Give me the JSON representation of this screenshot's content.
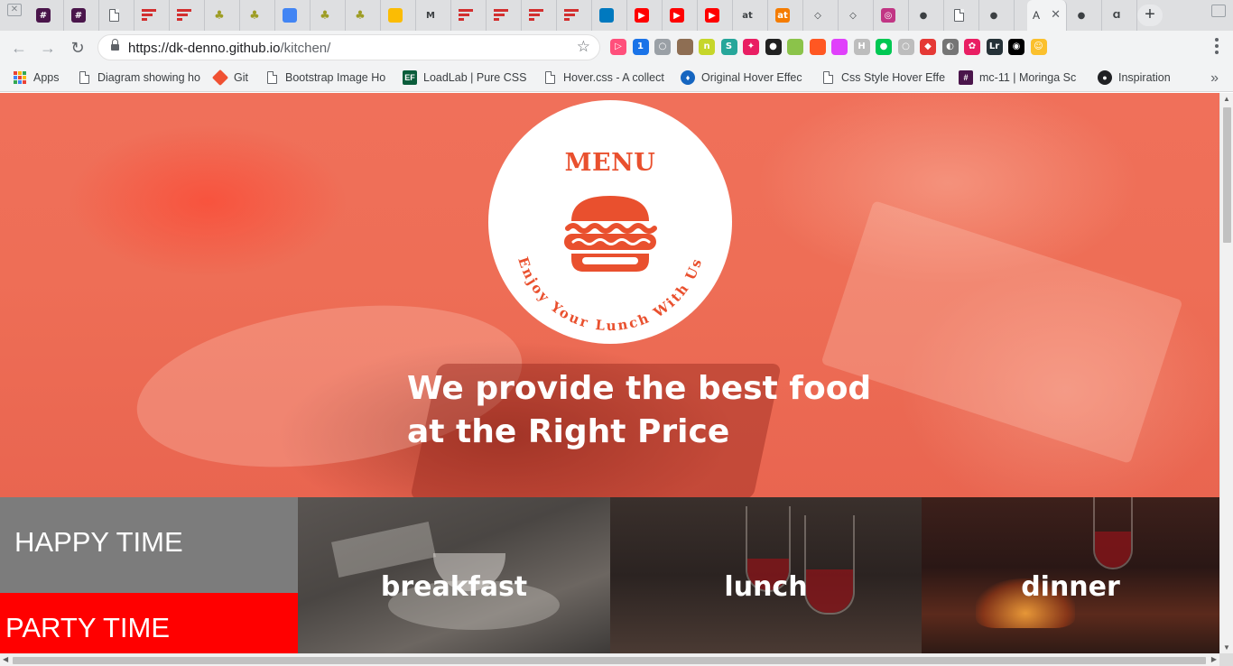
{
  "browser": {
    "active_tab_title": "A",
    "tabs": [
      {
        "icon": "slack-hash-icon",
        "glyph": "#",
        "color": "#4a154b"
      },
      {
        "icon": "slack-hash-icon",
        "glyph": "#",
        "color": "#4a154b"
      },
      {
        "icon": "page-icon",
        "glyph": "",
        "color": "#ffffff"
      },
      {
        "icon": "trello-red-icon",
        "glyph": "",
        "color": "#d32f2f"
      },
      {
        "icon": "trello-red-icon",
        "glyph": "",
        "color": "#d32f2f"
      },
      {
        "icon": "tree-icon",
        "glyph": "",
        "color": "#9e9d24"
      },
      {
        "icon": "tree-icon",
        "glyph": "",
        "color": "#9e9d24"
      },
      {
        "icon": "docs-icon",
        "glyph": "",
        "color": "#4285f4"
      },
      {
        "icon": "tree-icon",
        "glyph": "",
        "color": "#9e9d24"
      },
      {
        "icon": "tree-icon",
        "glyph": "",
        "color": "#9e9d24"
      },
      {
        "icon": "keep-icon",
        "glyph": "",
        "color": "#fbbc04"
      },
      {
        "icon": "gmail-icon",
        "glyph": "M",
        "color": "#ffffff"
      },
      {
        "icon": "red-bars-icon",
        "glyph": "",
        "color": "#d32f2f"
      },
      {
        "icon": "red-bars-icon",
        "glyph": "",
        "color": "#d32f2f"
      },
      {
        "icon": "red-bars-icon",
        "glyph": "",
        "color": "#d32f2f"
      },
      {
        "icon": "red-bars-icon",
        "glyph": "",
        "color": "#d32f2f"
      },
      {
        "icon": "trello-icon",
        "glyph": "",
        "color": "#0079bf"
      },
      {
        "icon": "youtube-icon",
        "glyph": "▶",
        "color": "#ff0000"
      },
      {
        "icon": "youtube-icon",
        "glyph": "▶",
        "color": "#ff0000"
      },
      {
        "icon": "youtube-icon",
        "glyph": "▶",
        "color": "#ff0000"
      },
      {
        "icon": "at-icon",
        "glyph": "at",
        "color": "#ffffff"
      },
      {
        "icon": "at-orange-icon",
        "glyph": "at",
        "color": "#f57c00"
      },
      {
        "icon": "codepen-icon",
        "glyph": "◇",
        "color": "#ffffff"
      },
      {
        "icon": "codepen-icon",
        "glyph": "◇",
        "color": "#ffffff"
      },
      {
        "icon": "instagram-icon",
        "glyph": "◎",
        "color": "#c13584"
      },
      {
        "icon": "github-icon",
        "glyph": "●",
        "color": "#ffffff"
      },
      {
        "icon": "page-icon",
        "glyph": "",
        "color": "#ffffff"
      },
      {
        "icon": "github-icon",
        "glyph": "●",
        "color": "#ffffff"
      }
    ],
    "after_active_tabs": [
      {
        "icon": "github-icon",
        "glyph": "●",
        "color": "#ffffff"
      },
      {
        "icon": "dk-icon",
        "glyph": "Ɑ",
        "color": "#ffffff"
      }
    ],
    "url_host": "https://dk-denno.github.io",
    "url_path": "/kitchen/",
    "extensions": [
      {
        "icon": "ext-play-icon",
        "color": "#ff4f7b",
        "glyph": "▷"
      },
      {
        "icon": "ext-ghostery-icon",
        "color": "#1a73e8",
        "glyph": "1"
      },
      {
        "icon": "ext-circle-icon",
        "color": "#9aa0a6",
        "glyph": "○"
      },
      {
        "icon": "ext-photo-icon",
        "color": "#8e6e53",
        "glyph": ""
      },
      {
        "icon": "ext-n-icon",
        "color": "#c6d62a",
        "glyph": "n"
      },
      {
        "icon": "ext-s-icon",
        "color": "#26a69a",
        "glyph": "S"
      },
      {
        "icon": "ext-unicorn-icon",
        "color": "#e91e63",
        "glyph": "✦"
      },
      {
        "icon": "ext-dark-circle-icon",
        "color": "#212121",
        "glyph": "●"
      },
      {
        "icon": "ext-green-square-icon",
        "color": "#8bc34a",
        "glyph": ""
      },
      {
        "icon": "ext-colorful-icon",
        "color": "#ff5722",
        "glyph": ""
      },
      {
        "icon": "ext-pink-page-icon",
        "color": "#e040fb",
        "glyph": ""
      },
      {
        "icon": "ext-h-icon",
        "color": "#bdbdbd",
        "glyph": "H"
      },
      {
        "icon": "ext-green-circle-icon",
        "color": "#00c853",
        "glyph": "●"
      },
      {
        "icon": "ext-grey-circle-icon",
        "color": "#bdbdbd",
        "glyph": "○"
      },
      {
        "icon": "ext-red-shield-icon",
        "color": "#e53935",
        "glyph": "◆"
      },
      {
        "icon": "ext-bulb-icon",
        "color": "#757575",
        "glyph": "◐"
      },
      {
        "icon": "ext-colorwheel-icon",
        "color": "#e91e63",
        "glyph": "✿"
      },
      {
        "icon": "ext-lr-icon",
        "color": "#263238",
        "glyph": "Lr"
      },
      {
        "icon": "ext-black-circle-icon",
        "color": "#000000",
        "glyph": "◉"
      },
      {
        "icon": "ext-emoji-icon",
        "color": "#fbc02d",
        "glyph": "☺"
      }
    ]
  },
  "bookmarks": [
    {
      "label": "Apps",
      "icon": "apps-grid-icon"
    },
    {
      "label": "Diagram showing ho",
      "icon": "page-icon"
    },
    {
      "label": "Git",
      "icon": "git-icon"
    },
    {
      "label": "Bootstrap Image Ho",
      "icon": "page-icon"
    },
    {
      "label": "LoadLab | Pure CSS",
      "icon": "ef-icon"
    },
    {
      "label": "Hover.css - A collect",
      "icon": "page-icon"
    },
    {
      "label": "Original Hover Effec",
      "icon": "drop-icon"
    },
    {
      "label": "Css Style Hover Effe",
      "icon": "page-icon"
    },
    {
      "label": "mc-11 | Moringa Sc",
      "icon": "slack-hash-icon"
    },
    {
      "label": "Inspiration",
      "icon": "github-icon"
    }
  ],
  "page": {
    "badge": {
      "title": "MENU",
      "arc_text": "Enjoy Your Lunch With Us"
    },
    "tagline": {
      "line1": "We provide the best food",
      "line2": "at the Right Price"
    },
    "happy_time": "HAPPY TIME",
    "party_time": "PARTY TIME",
    "meals": {
      "breakfast": "breakfast",
      "lunch": "lunch",
      "dinner": "dinner"
    }
  },
  "colors": {
    "brand": "#e9502e",
    "hero_overlay": "#ef6d55",
    "happy_bg": "#7c7c7c",
    "party_bg": "#ff0000"
  }
}
